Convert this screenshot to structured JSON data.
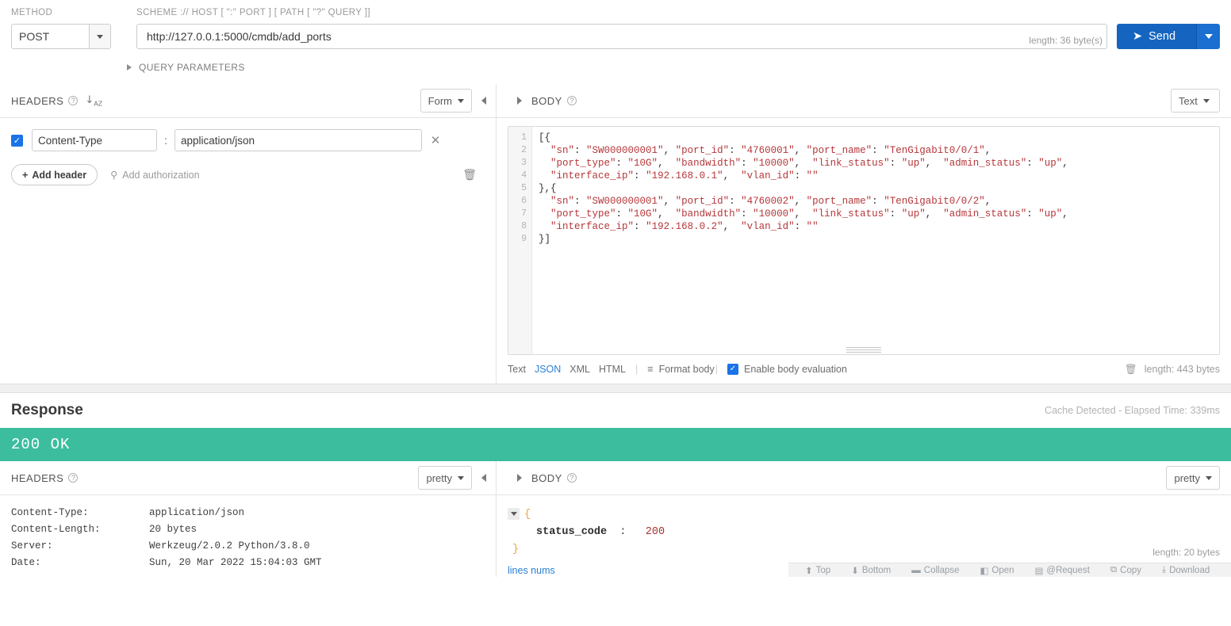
{
  "request": {
    "method_label": "METHOD",
    "method_value": "POST",
    "url_label": "SCHEME :// HOST [ \":\" PORT ] [ PATH [ \"?\" QUERY ]]",
    "url_value": "http://127.0.0.1:5000/cmdb/add_ports",
    "url_length_note": "length: 36 byte(s)",
    "send_label": "Send",
    "query_parameters_label": "QUERY PARAMETERS"
  },
  "headers_panel": {
    "title": "HEADERS",
    "help_glyph": "?",
    "sort_glyph": "↓",
    "mode_label": "Form",
    "rows": [
      {
        "enabled": true,
        "key": "Content-Type",
        "separator": ":",
        "value": "application/json",
        "remove_glyph": "✕"
      }
    ],
    "add_header_label": "Add header",
    "add_header_plus": "+",
    "add_authorization_label": "Add authorization",
    "key_icon": "⚲",
    "trash_glyph": "🗑"
  },
  "body_panel": {
    "title": "BODY",
    "help_glyph": "?",
    "mode_label": "Text",
    "line_numbers": [
      "1",
      "2",
      "3",
      "4",
      "5",
      "6",
      "7",
      "8",
      "9"
    ],
    "code_lines": [
      "[{",
      "  \"sn\": \"SW000000001\", \"port_id\": \"4760001\", \"port_name\": \"TenGigabit0/0/1\",",
      "  \"port_type\": \"10G\",  \"bandwidth\": \"10000\",  \"link_status\": \"up\",  \"admin_status\": \"up\",",
      "  \"interface_ip\": \"192.168.0.1\",  \"vlan_id\": \"\"",
      "},{",
      "  \"sn\": \"SW000000001\", \"port_id\": \"4760002\", \"port_name\": \"TenGigabit0/0/2\",",
      "  \"port_type\": \"10G\",  \"bandwidth\": \"10000\",  \"link_status\": \"up\",  \"admin_status\": \"up\",",
      "  \"interface_ip\": \"192.168.0.2\",  \"vlan_id\": \"\"",
      "}]"
    ],
    "formats": [
      {
        "label": "Text",
        "active": false
      },
      {
        "label": "JSON",
        "active": true
      },
      {
        "label": "XML",
        "active": false
      },
      {
        "label": "HTML",
        "active": false
      }
    ],
    "format_body_label": "Format body",
    "format_body_icon": "≡",
    "enable_evaluation_label": "Enable body evaluation",
    "enable_evaluation_checked": true,
    "trash_glyph": "🗑",
    "length_label": "length: 443 bytes",
    "divider": "|"
  },
  "response": {
    "title": "Response",
    "meta": "Cache Detected - Elapsed Time: 339ms",
    "status_text": "200 OK",
    "status_color": "#3bbd9e",
    "headers_panel": {
      "title": "HEADERS",
      "help_glyph": "?",
      "mode_label": "pretty",
      "rows": [
        {
          "key": "Content-Type:",
          "value": "application/json"
        },
        {
          "key": "Content-Length:",
          "value": "20 bytes"
        },
        {
          "key": "Server:",
          "value": "Werkzeug/2.0.2 Python/3.8.0"
        },
        {
          "key": "Date:",
          "value": "Sun, 20 Mar 2022 15:04:03 GMT"
        }
      ]
    },
    "body_panel": {
      "title": "BODY",
      "help_glyph": "?",
      "mode_label": "pretty",
      "open_brace": "{",
      "close_brace": "}",
      "field_key": "status_code",
      "field_colon": ":",
      "field_value": "200",
      "lines_nums_label": "lines nums",
      "length_label": "length: 20 bytes",
      "toolbar": [
        {
          "label": "Top",
          "icon": "⬆"
        },
        {
          "label": "Bottom",
          "icon": "⬇"
        },
        {
          "label": "Collapse",
          "icon": "▬"
        },
        {
          "label": "Open",
          "icon": "◧"
        },
        {
          "label": "@Request",
          "icon": "▤"
        },
        {
          "label": "Copy",
          "icon": "⧉"
        },
        {
          "label": "Download",
          "icon": "⤓"
        }
      ]
    }
  },
  "theme": {
    "accent_blue": "#1565c0",
    "link_blue": "#2b7fd4",
    "success_green": "#3bbd9e"
  }
}
